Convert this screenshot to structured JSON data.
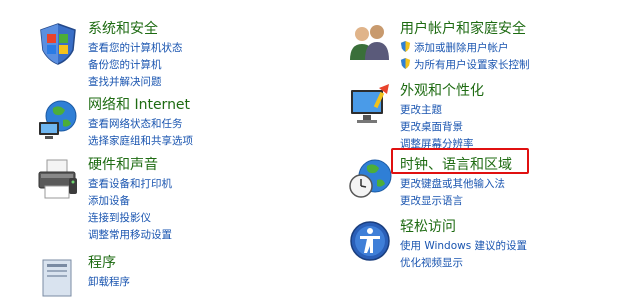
{
  "left_column": [
    {
      "title": "系统和安全",
      "icon": "shield-flag-icon",
      "links": [
        "查看您的计算机状态",
        "备份您的计算机",
        "查找并解决问题"
      ]
    },
    {
      "title": "网络和 Internet",
      "icon": "network-globe-icon",
      "links": [
        "查看网络状态和任务",
        "选择家庭组和共享选项"
      ]
    },
    {
      "title": "硬件和声音",
      "icon": "printer-icon",
      "links": [
        "查看设备和打印机",
        "添加设备",
        "连接到投影仪",
        "调整常用移动设置"
      ]
    },
    {
      "title": "程序",
      "icon": "programs-icon",
      "links": [
        "卸载程序"
      ]
    }
  ],
  "right_column": [
    {
      "title": "用户帐户和家庭安全",
      "icon": "users-icon",
      "links": [
        "添加或删除用户帐户",
        "为所有用户设置家长控制"
      ]
    },
    {
      "title": "外观和个性化",
      "icon": "display-paint-icon",
      "links": [
        "更改主题",
        "更改桌面背景",
        "调整屏幕分辨率"
      ]
    },
    {
      "title": "时钟、语言和区域",
      "icon": "clock-globe-icon",
      "links": [
        "更改键盘或其他输入法",
        "更改显示语言"
      ]
    },
    {
      "title": "轻松访问",
      "icon": "ease-of-access-icon",
      "links": [
        "使用 Windows 建议的设置",
        "优化视频显示"
      ]
    }
  ],
  "highlight_color": "#e01010"
}
